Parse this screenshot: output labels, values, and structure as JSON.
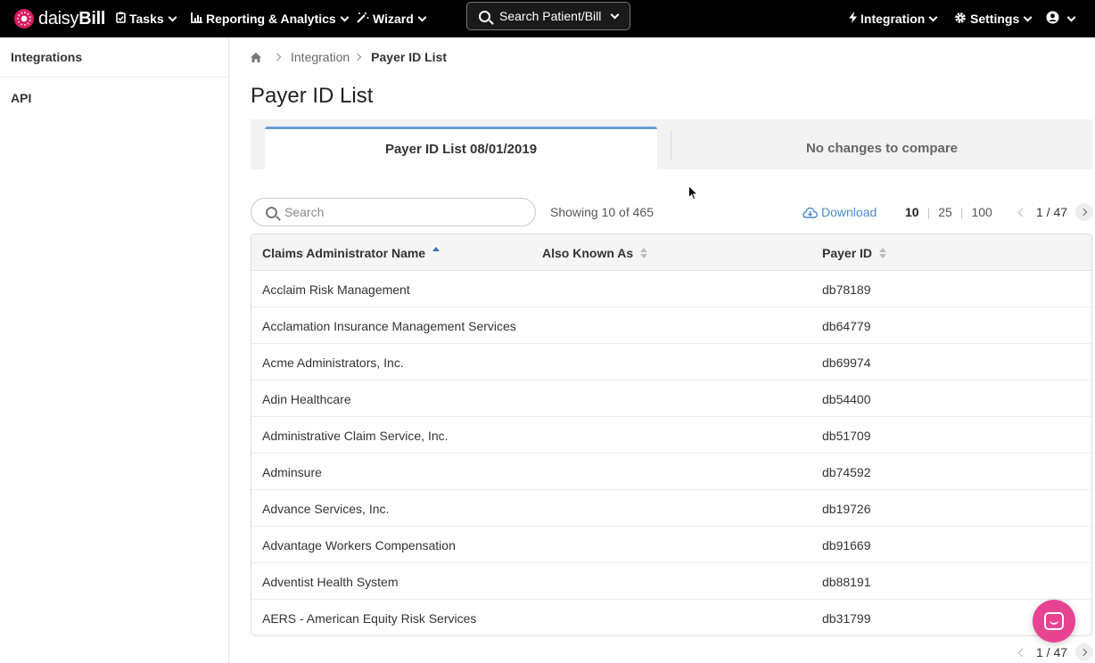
{
  "nav": {
    "logo_prefix": "daisy",
    "logo_suffix": "Bill",
    "tasks": "Tasks",
    "reporting": "Reporting & Analytics",
    "wizard": "Wizard",
    "search": "Search Patient/Bill",
    "integration": "Integration",
    "settings": "Settings"
  },
  "sidebar": {
    "items": [
      {
        "label": "Integrations"
      },
      {
        "label": "API"
      }
    ]
  },
  "breadcrumb": {
    "parent": "Integration",
    "current": "Payer ID List"
  },
  "page": {
    "title": "Payer ID List"
  },
  "tabs": {
    "active": "Payer ID List 08/01/2019",
    "inactive": "No changes to compare"
  },
  "toolbar": {
    "search_placeholder": "Search",
    "showing": "Showing 10 of 465",
    "download": "Download",
    "page_sizes": [
      "10",
      "25",
      "100"
    ],
    "page_indicator": "1 / 47"
  },
  "table": {
    "headers": {
      "name": "Claims Administrator Name",
      "aka": "Also Known As",
      "payer_id": "Payer ID"
    },
    "rows": [
      {
        "name": "Acclaim Risk Management",
        "aka": "",
        "payer_id": "db78189"
      },
      {
        "name": "Acclamation Insurance Management Services",
        "aka": "",
        "payer_id": "db64779"
      },
      {
        "name": "Acme Administrators, Inc.",
        "aka": "",
        "payer_id": "db69974"
      },
      {
        "name": "Adin Healthcare",
        "aka": "",
        "payer_id": "db54400"
      },
      {
        "name": "Administrative Claim Service, Inc.",
        "aka": "",
        "payer_id": "db51709"
      },
      {
        "name": "Adminsure",
        "aka": "",
        "payer_id": "db74592"
      },
      {
        "name": "Advance Services, Inc.",
        "aka": "",
        "payer_id": "db19726"
      },
      {
        "name": "Advantage Workers Compensation",
        "aka": "",
        "payer_id": "db91669"
      },
      {
        "name": "Adventist Health System",
        "aka": "",
        "payer_id": "db88191"
      },
      {
        "name": "AERS - American Equity Risk Services",
        "aka": "",
        "payer_id": "db31799"
      }
    ]
  },
  "footer": {
    "page_indicator": "1 / 47"
  },
  "colors": {
    "accent": "#4a8bd1",
    "tab_highlight": "#6a9fd8",
    "chat_bubble": "#e84393"
  }
}
